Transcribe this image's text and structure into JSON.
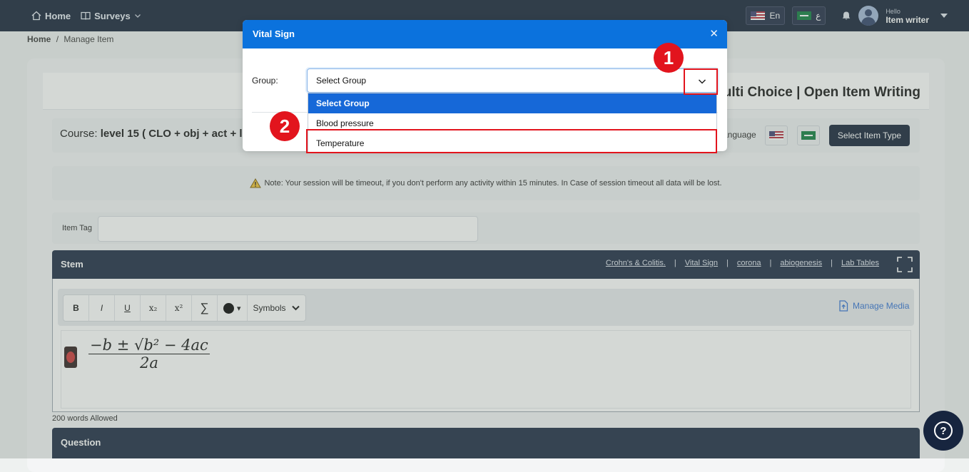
{
  "nav": {
    "home": "Home",
    "surveys": "Surveys",
    "lang_en": "En",
    "lang_ar": "ع",
    "hello": "Hello",
    "user_name": "Item writer"
  },
  "breadcrumb": {
    "home": "Home",
    "separator": "/",
    "current": "Manage Item"
  },
  "page": {
    "title": "Multi Choice | Open Item Writing",
    "course_label": "Course:",
    "course_value": "level 15 ( CLO + obj + act + l",
    "language_label": "anguage",
    "select_item_type": "Select Item Type",
    "note": "Note: Your session will be timeout, if you don't perform any activity within 15 minutes. In Case of session timeout all data will be lost.",
    "item_tag_label": "Item Tag",
    "item_tag_value": ""
  },
  "stem": {
    "title": "Stem",
    "links": [
      "Crohn's & Colitis.",
      "Vital Sign",
      "corona",
      "abiogenesis",
      "Lab Tables"
    ],
    "separator": "|",
    "toolbar": {
      "bold": "B",
      "italic": "I",
      "underline": "U",
      "subscript": "x₂",
      "superscript": "x²",
      "sum": "∑",
      "color_caret": "▾",
      "symbols": "Symbols"
    },
    "manage_media": "Manage Media",
    "formula_numerator": "−b ± √b² − 4ac",
    "formula_denominator": "2a",
    "words_allowed": "200 words Allowed"
  },
  "question": {
    "title": "Question"
  },
  "help": {
    "label": "?"
  },
  "modal": {
    "title": "Vital Sign",
    "close": "✕",
    "group_label": "Group:",
    "select_value": "Select Group",
    "options": [
      "Select Group",
      "Blood pressure",
      "Temperature"
    ]
  },
  "annotations": {
    "badge1": "1",
    "badge2": "2"
  },
  "colors": {
    "nav_bg": "#0f1c33",
    "modal_header": "#0b72dd",
    "selected_option": "#1668d8",
    "annotation_red": "#e2141d"
  }
}
